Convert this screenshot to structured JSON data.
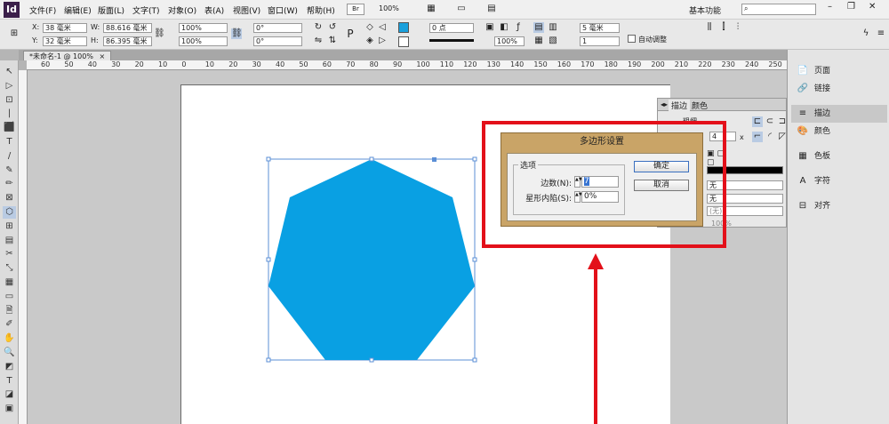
{
  "app": {
    "logo": "Id",
    "window_controls": [
      "–",
      "❐",
      "✕"
    ]
  },
  "menu": [
    "文件(F)",
    "编辑(E)",
    "版面(L)",
    "文字(T)",
    "对象(O)",
    "表(A)",
    "视图(V)",
    "窗口(W)",
    "帮助(H)"
  ],
  "topbar": {
    "br_label": "Br",
    "zoom": "100%",
    "workspace": "基本功能",
    "search_placeholder": ""
  },
  "options": {
    "x_label": "X:",
    "x": "38 毫米",
    "y_label": "Y:",
    "y": "32 毫米",
    "w_label": "W:",
    "w": "88.616 毫米",
    "h_label": "H:",
    "h": "86.395 毫米",
    "scale_x": "100%",
    "scale_y": "100%",
    "rot": "0°",
    "shear": "0°",
    "stroke_weight": "0 点",
    "opacity": "100%",
    "stroke_offset": "5 毫米",
    "corner_size": "1",
    "auto_fit": "自动调整",
    "fill_color": "#1aa0dc"
  },
  "doc_tab": "*未命名-1 @ 100%",
  "ruler_ticks": [
    "60",
    "50",
    "40",
    "30",
    "20",
    "10",
    "0",
    "10",
    "20",
    "30",
    "40",
    "50",
    "60",
    "70",
    "80",
    "90",
    "100",
    "110",
    "120",
    "130",
    "140",
    "150",
    "160",
    "170",
    "180",
    "190",
    "200",
    "210",
    "220",
    "230",
    "240",
    "250"
  ],
  "toolbox": [
    "↖",
    "▷",
    "⊡",
    "|↔|",
    "⬛",
    "T",
    "/",
    "✎",
    "✏",
    "⊠",
    "⬡",
    "⊞",
    "▤",
    "✂",
    "⤡",
    "▦",
    "▭",
    "🗎",
    "✐",
    "✋",
    "🔍",
    "◩",
    "T",
    "◪",
    "▣"
  ],
  "shape": {
    "fill": "#09a0e3",
    "name": "heptagon"
  },
  "stroke_panel": {
    "tab_stroke": "描边",
    "tab_color": "颜色",
    "weight_label": "粗细",
    "join_value": "4",
    "miter_x": "x",
    "type_values": [
      "无",
      "无"
    ],
    "none_label": "(无)",
    "tint": "100%"
  },
  "right_panel": [
    {
      "label": "页面",
      "icon": "📄"
    },
    {
      "label": "链接",
      "icon": "🔗"
    },
    {
      "label": "描边",
      "icon": "≡"
    },
    {
      "label": "颜色",
      "icon": "🎨"
    },
    {
      "label": "色板",
      "icon": "▦"
    },
    {
      "label": "字符",
      "icon": "A"
    },
    {
      "label": "对齐",
      "icon": "⊟"
    }
  ],
  "dialog": {
    "title": "多边形设置",
    "group": "选项",
    "sides_label": "边数(N):",
    "sides_value": "7",
    "star_label": "星形内陷(S):",
    "star_value": "0%",
    "ok": "确定",
    "cancel": "取消"
  }
}
